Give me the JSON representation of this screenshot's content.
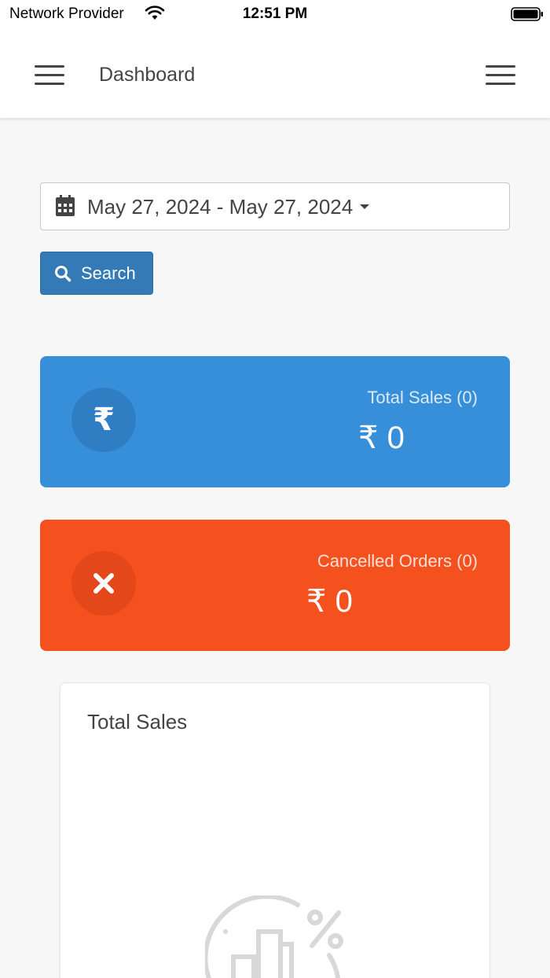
{
  "status_bar": {
    "carrier": "Network Provider",
    "time": "12:51 PM"
  },
  "header": {
    "title": "Dashboard"
  },
  "filters": {
    "date_range": "May 27, 2024 - May 27, 2024",
    "search_label": "Search"
  },
  "cards": [
    {
      "label": "Total Sales (0)",
      "value": "₹ 0",
      "icon": "rupee-icon",
      "color": "#378fd9"
    },
    {
      "label": "Cancelled Orders (0)",
      "value": "₹ 0",
      "icon": "close-icon",
      "color": "#f5511e"
    }
  ],
  "chart": {
    "title": "Total Sales"
  },
  "colors": {
    "primary_button": "#337ab7",
    "sales_card": "#378fd9",
    "cancel_card": "#f5511e"
  }
}
